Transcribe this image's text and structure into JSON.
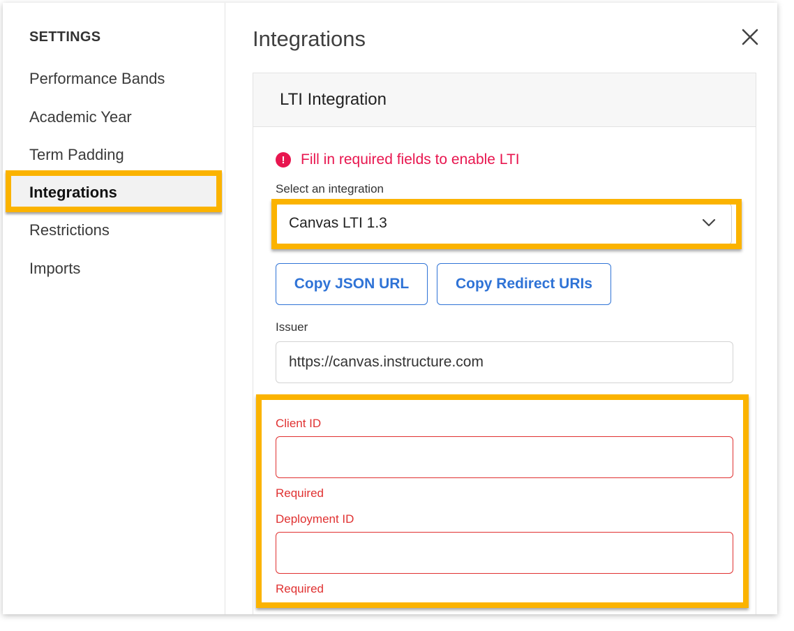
{
  "sidebar": {
    "heading": "SETTINGS",
    "items": [
      {
        "label": "Performance Bands"
      },
      {
        "label": "Academic Year"
      },
      {
        "label": "Term Padding"
      },
      {
        "label": "Integrations",
        "active": true
      },
      {
        "label": "Restrictions"
      },
      {
        "label": "Imports"
      }
    ]
  },
  "main": {
    "title": "Integrations",
    "close_icon": "close-icon",
    "card": {
      "title": "LTI Integration",
      "alert": {
        "icon": "error-circle-icon",
        "icon_glyph": "!",
        "text": "Fill in required fields to enable LTI"
      },
      "select": {
        "label": "Select an integration",
        "value": "Canvas LTI 1.3",
        "icon": "chevron-down-icon"
      },
      "buttons": [
        {
          "label": "Copy JSON URL"
        },
        {
          "label": "Copy Redirect URIs"
        }
      ],
      "issuer": {
        "label": "Issuer",
        "value": "https://canvas.instructure.com"
      },
      "client_id": {
        "label": "Client ID",
        "value": "",
        "helper": "Required"
      },
      "deployment_id": {
        "label": "Deployment ID",
        "value": "",
        "helper": "Required"
      }
    }
  },
  "colors": {
    "highlight": "#fbb300",
    "error": "#e03131",
    "alert": "#e8164f",
    "link_blue": "#2f73d6"
  }
}
